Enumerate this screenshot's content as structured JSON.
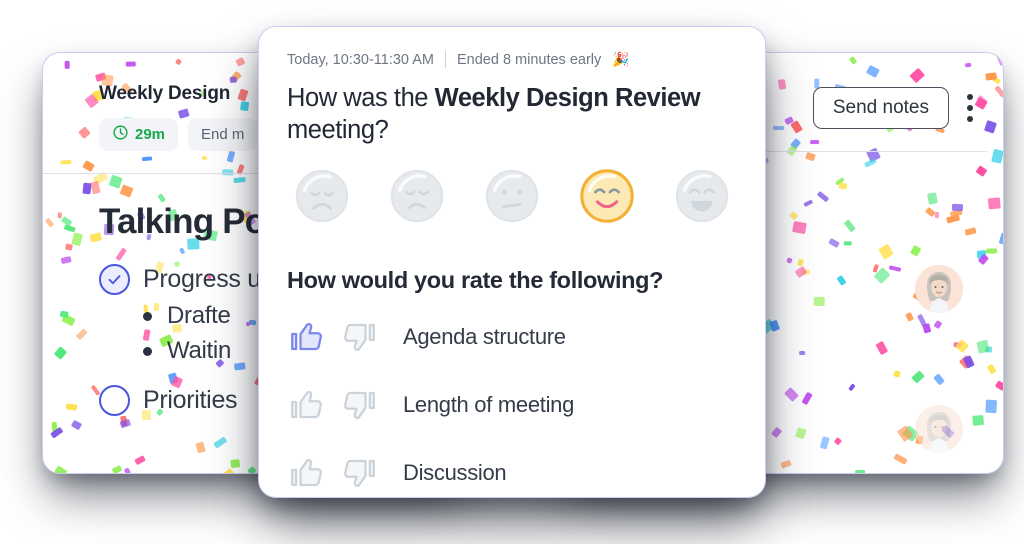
{
  "left_card": {
    "title": "Weekly Design",
    "timer_chip": {
      "icon": "clock-icon",
      "label": "29m"
    },
    "end_meeting_button": "End m",
    "talking_points_heading": "Talking Po",
    "items": [
      {
        "text": "Progress u",
        "checked": true,
        "subitems": [
          "Drafte",
          "Waitin"
        ]
      },
      {
        "text": "Priorities ",
        "checked": false,
        "subitems": []
      }
    ]
  },
  "right_card": {
    "send_notes_button": "Send notes",
    "overflow_menu": "kebab-menu-icon",
    "avatars": [
      "avatar-1",
      "avatar-2"
    ]
  },
  "modal": {
    "meta": {
      "time_range": "Today, 10:30-11:30 AM",
      "status": "Ended 8 minutes early",
      "status_emoji": "🎉"
    },
    "question_1": {
      "prefix": "How was the ",
      "meeting_name": "Weekly Design Review",
      "suffix": " meeting?"
    },
    "faces": [
      {
        "name": "face-sad",
        "selected": false
      },
      {
        "name": "face-disappointed",
        "selected": false
      },
      {
        "name": "face-neutral",
        "selected": false
      },
      {
        "name": "face-smiling",
        "selected": true
      },
      {
        "name": "face-grinning",
        "selected": false
      }
    ],
    "question_2": "How would you rate the following?",
    "rate_rows": [
      {
        "label": "Agenda structure",
        "thumbs_up_selected": true,
        "thumbs_down_selected": false
      },
      {
        "label": "Length of meeting",
        "thumbs_up_selected": false,
        "thumbs_down_selected": false
      },
      {
        "label": "Discussion",
        "thumbs_up_selected": false,
        "thumbs_down_selected": false
      }
    ]
  },
  "colors": {
    "accent_blue": "#4b56e0",
    "timer_green": "#17a94a",
    "selected_yellow": "#f7c948",
    "card_border": "#c9cdf2",
    "text_dark": "#222934",
    "text_muted": "#6e7684"
  },
  "confetti_palette": [
    "#35d0e8",
    "#7a4fe8",
    "#ff4fa3",
    "#4fe87a",
    "#ffe14f",
    "#ff9a4f",
    "#4f9aff",
    "#ff6b6b",
    "#8ef04f",
    "#c14ff0"
  ]
}
